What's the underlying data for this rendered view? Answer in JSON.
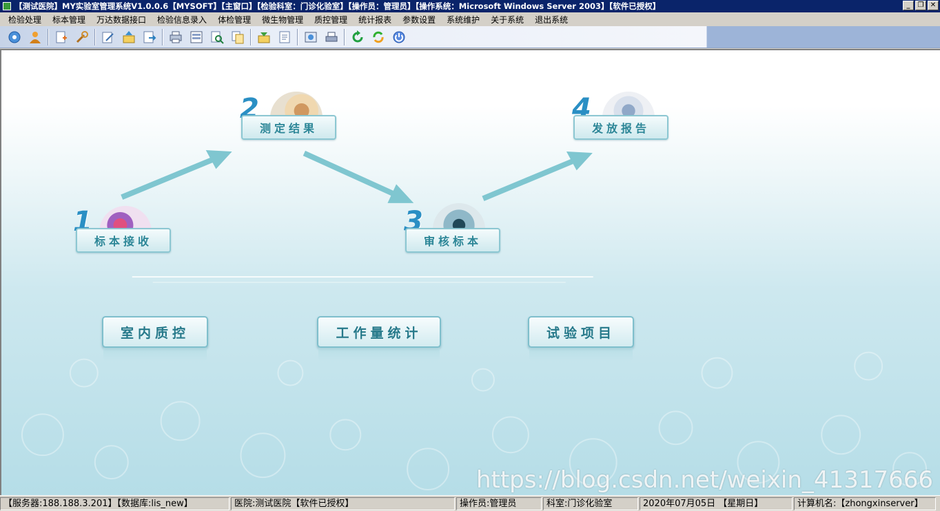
{
  "window": {
    "title": "【测试医院】MY实验室管理系统V1.0.0.6【MYSOFT】【主窗口】【检验科室：门诊化验室】【操作员：管理员】【操作系统：Microsoft Windows Server 2003】【软件已授权】",
    "controls": [
      "_",
      "❐",
      "✕"
    ]
  },
  "menu": {
    "items": [
      "检验处理",
      "标本管理",
      "万达数据接口",
      "检验信息录入",
      "体检管理",
      "微生物管理",
      "质控管理",
      "统计报表",
      "参数设置",
      "系统维护",
      "关于系统",
      "退出系统"
    ]
  },
  "toolbar": {
    "icons": [
      "settings-gear-icon",
      "user-icon",
      "add-document-icon",
      "tools-icon",
      "edit-icon",
      "upload-icon",
      "export-icon",
      "print-icon",
      "print-preview-icon",
      "search-document-icon",
      "copy-icon",
      "import-icon",
      "report-icon",
      "view-icon",
      "printer-icon",
      "refresh-icon",
      "sync-icon",
      "power-icon"
    ]
  },
  "workflow": {
    "steps": [
      {
        "number": "1",
        "label": "标本接收"
      },
      {
        "number": "2",
        "label": "测定结果"
      },
      {
        "number": "3",
        "label": "审核标本"
      },
      {
        "number": "4",
        "label": "发放报告"
      }
    ],
    "shortcuts": [
      {
        "label": "室内质控"
      },
      {
        "label": "工作量统计"
      },
      {
        "label": "试验项目"
      }
    ]
  },
  "watermark": "https://blog.csdn.net/weixin_41317666",
  "statusbar": {
    "server": "【服务器:188.188.3.201】【数据库:lis_new】",
    "hospital": "医院:测试医院【软件已授权】",
    "operator": "操作员:管理员",
    "department": "科室:门诊化验室",
    "date": "2020年07月05日 【星期日】",
    "computer": "计算机名:【zhongxinserver】"
  },
  "colors": {
    "titlebar": "#0a246a",
    "accent": "#2a8fc4",
    "button_text": "#2c8697"
  }
}
